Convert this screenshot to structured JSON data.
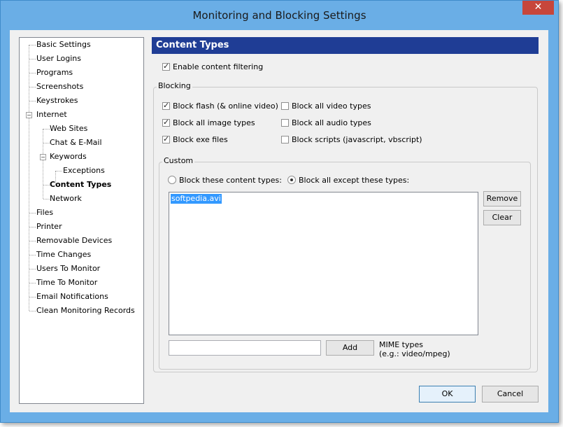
{
  "window": {
    "title": "Monitoring and Blocking Settings",
    "close_glyph": "✕"
  },
  "tree": {
    "items": [
      {
        "label": "Basic Settings"
      },
      {
        "label": "User Logins"
      },
      {
        "label": "Programs"
      },
      {
        "label": "Screenshots"
      },
      {
        "label": "Keystrokes"
      },
      {
        "label": "Internet"
      },
      {
        "label": "Web Sites"
      },
      {
        "label": "Chat & E-Mail"
      },
      {
        "label": "Keywords"
      },
      {
        "label": "Exceptions"
      },
      {
        "label": "Content Types"
      },
      {
        "label": "Network"
      },
      {
        "label": "Files"
      },
      {
        "label": "Printer"
      },
      {
        "label": "Removable Devices"
      },
      {
        "label": "Time Changes"
      },
      {
        "label": "Users To Monitor"
      },
      {
        "label": "Time To Monitor"
      },
      {
        "label": "Email Notifications"
      },
      {
        "label": "Clean Monitoring Records"
      }
    ],
    "expander_glyph": "−"
  },
  "panel": {
    "title": "Content Types",
    "enable_filtering": {
      "label": "Enable content filtering",
      "checked": true
    },
    "blocking": {
      "title": "Blocking",
      "options": [
        {
          "label": "Block flash (& online video)",
          "checked": true
        },
        {
          "label": "Block all video types",
          "checked": false
        },
        {
          "label": "Block all image types",
          "checked": true
        },
        {
          "label": "Block all audio types",
          "checked": false
        },
        {
          "label": "Block exe files",
          "checked": true
        },
        {
          "label": "Block scripts (javascript, vbscript)",
          "checked": false
        }
      ]
    },
    "custom": {
      "title": "Custom",
      "radio_block_these": {
        "label": "Block these content types:",
        "selected": false
      },
      "radio_block_except": {
        "label": "Block all except these types:",
        "selected": true
      },
      "list_items": [
        "softpedia.avi"
      ],
      "remove_label": "Remove",
      "clear_label": "Clear",
      "mime_input_value": "",
      "add_label": "Add",
      "mime_hint_line1": "MIME types",
      "mime_hint_line2": "(e.g.: video/mpeg)"
    }
  },
  "footer": {
    "ok_label": "OK",
    "cancel_label": "Cancel"
  },
  "colors": {
    "titlebar": "#6aaee6",
    "panel_header": "#1f3d95",
    "close_button": "#c7463b",
    "selection": "#3399ff"
  }
}
